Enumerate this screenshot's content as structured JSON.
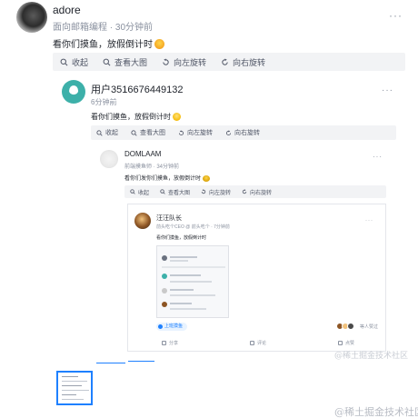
{
  "post": {
    "author": "adore",
    "meta": "面向邮箱编程 · 30分钟前",
    "more": "···",
    "content": "看你们摸鱼，放假倒计时"
  },
  "toolbar": {
    "collapse": "收起",
    "view_large": "查看大图",
    "rotate_left": "向左旋转",
    "rotate_right": "向右旋转"
  },
  "level2": {
    "author": "用户3516676449132",
    "meta": "6分钟前",
    "more": "···",
    "content": "看你们摸鱼，放假倒计时"
  },
  "level3": {
    "author": "DOMLAAM",
    "meta": "前端摸鱼师 · 34分钟前",
    "more": "···",
    "content": "看你们发你们摸鱼，放假倒计时"
  },
  "level4": {
    "author": "汪汪队长",
    "meta": "前头吃个CEO @ 前头吃个 · 7分钟前",
    "more": "···",
    "content": "看你们摸鱼，放假倒计时",
    "tag": "上班摸鱼",
    "likes_text": "等人赞过",
    "share": "分享",
    "comment": "评论",
    "like": "点赞"
  },
  "watermarks": {
    "inner": "@稀土掘金技术社区",
    "outer": "@稀土掘金技术社区"
  },
  "colors": {
    "accent": "#1e80ff",
    "toolbar_bg": "#f2f3f5",
    "muted": "#8a919f"
  }
}
